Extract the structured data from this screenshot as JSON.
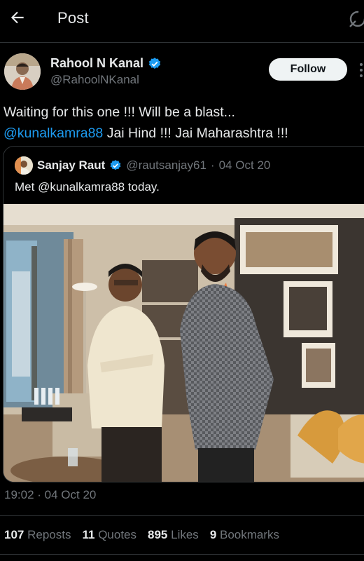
{
  "header": {
    "title": "Post",
    "back_icon": "arrow-left-icon",
    "refresh_icon": "refresh-icon"
  },
  "author": {
    "name": "Rahool N Kanal",
    "handle": "@RahoolNKanal",
    "verified": true,
    "follow_label": "Follow"
  },
  "tweet": {
    "line1": "Waiting for this one !!! Will be a blast...",
    "mention": "@kunalkamra88",
    "line2_rest": " Jai Hind !!! Jai Maharashtra !!!"
  },
  "quote": {
    "name": "Sanjay Raut",
    "handle": "@rautsanjay61",
    "separator": "·",
    "date": "04 Oct 20",
    "text_prefix": "Met ",
    "mention": "@kunalkamra88",
    "text_suffix": " today."
  },
  "meta": {
    "timestamp": "19:02 · 04 Oct 20"
  },
  "stats": [
    {
      "count": "107",
      "label": "Reposts"
    },
    {
      "count": "11",
      "label": "Quotes"
    },
    {
      "count": "895",
      "label": "Likes"
    },
    {
      "count": "9",
      "label": "Bookmarks"
    }
  ],
  "colors": {
    "background": "#000000",
    "text": "#e7e9ea",
    "muted": "#71767b",
    "link": "#1d9bf0",
    "verified": "#1d9bf0",
    "follow_bg": "#eff3f4"
  }
}
